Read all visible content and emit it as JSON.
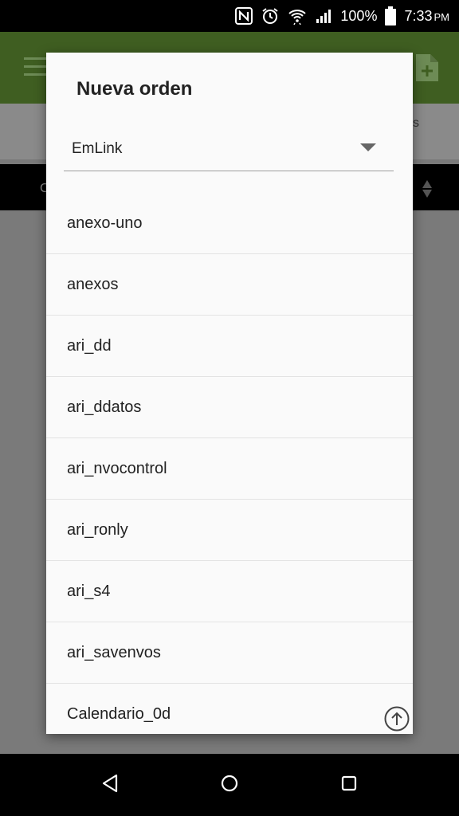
{
  "status_bar": {
    "battery_percent": "100%",
    "time": "7:33",
    "ampm": "PM",
    "icons": [
      "nfc-icon",
      "alarm-icon",
      "wifi-icon",
      "signal-icon",
      "battery-icon"
    ]
  },
  "app": {
    "toolbar_color": "#3f5e21",
    "subheader_partial_text": "s",
    "tab_partial_text": "C"
  },
  "dialog": {
    "title": "Nueva orden",
    "spinner_value": "EmLink",
    "items": [
      "anexo-uno",
      "anexos",
      "ari_dd",
      "ari_ddatos",
      "ari_nvocontrol",
      "ari_ronly",
      "ari_s4",
      "ari_savenvos",
      "Calendario_0d"
    ]
  },
  "navbar": {
    "icons": [
      "back-icon",
      "home-icon",
      "recents-icon"
    ]
  }
}
